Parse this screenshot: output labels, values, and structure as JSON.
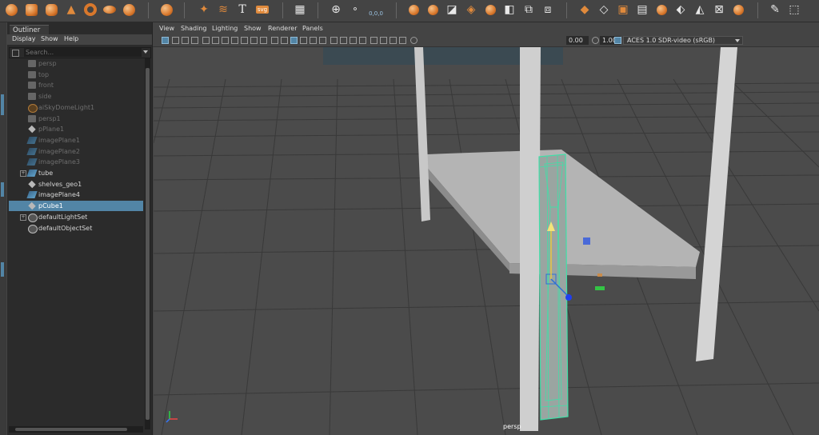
{
  "shelf": {
    "icons_orange": [
      "sphere-icon",
      "cube-icon",
      "cylinder-icon",
      "cone-icon",
      "torus-icon",
      "disk-icon",
      "plane-icon"
    ],
    "text_label": "svg",
    "coord_label": "0,0,0"
  },
  "outliner": {
    "tab": "Outliner",
    "menu": [
      "Display",
      "Show",
      "Help"
    ],
    "search_placeholder": "Search...",
    "items": [
      {
        "label": "persp",
        "icon": "camera-icon",
        "dim": true,
        "expander": false
      },
      {
        "label": "top",
        "icon": "camera-icon",
        "dim": true,
        "expander": false
      },
      {
        "label": "front",
        "icon": "camera-icon",
        "dim": true,
        "expander": false
      },
      {
        "label": "side",
        "icon": "camera-icon",
        "dim": true,
        "expander": false
      },
      {
        "label": "aiSkyDomeLight1",
        "icon": "skydome-icon",
        "dim": true,
        "expander": false
      },
      {
        "label": "persp1",
        "icon": "camera-icon",
        "dim": true,
        "expander": false
      },
      {
        "label": "pPlane1",
        "icon": "mesh-icon",
        "dim": true,
        "expander": false
      },
      {
        "label": "imagePlane1",
        "icon": "imageplane-icon",
        "dim": true,
        "expander": false
      },
      {
        "label": "imagePlane2",
        "icon": "imageplane-icon",
        "dim": true,
        "expander": false
      },
      {
        "label": "imagePlane3",
        "icon": "imageplane-icon",
        "dim": true,
        "expander": false
      },
      {
        "label": "tube",
        "icon": "group-icon",
        "dim": false,
        "expander": true
      },
      {
        "label": "shelves_geo1",
        "icon": "mesh-icon",
        "dim": false,
        "expander": false
      },
      {
        "label": "imagePlane4",
        "icon": "imageplane-icon",
        "dim": false,
        "expander": false
      },
      {
        "label": "pCube1",
        "icon": "mesh-icon",
        "dim": false,
        "expander": false,
        "selected": true
      },
      {
        "label": "defaultLightSet",
        "icon": "set-icon",
        "dim": false,
        "expander": true
      },
      {
        "label": "defaultObjectSet",
        "icon": "set-icon",
        "dim": false,
        "expander": false
      }
    ]
  },
  "viewport": {
    "menu": [
      "View",
      "Shading",
      "Lighting",
      "Show",
      "Renderer",
      "Panels"
    ],
    "exposure": "0.00",
    "gamma": "1.00",
    "color_space": "ACES 1.0 SDR-video (sRGB)",
    "camera": "persp"
  },
  "colors": {
    "selection": "#5285a6",
    "wire_selected": "#3fe0a8",
    "shelf_orange": "#e08a3c"
  }
}
